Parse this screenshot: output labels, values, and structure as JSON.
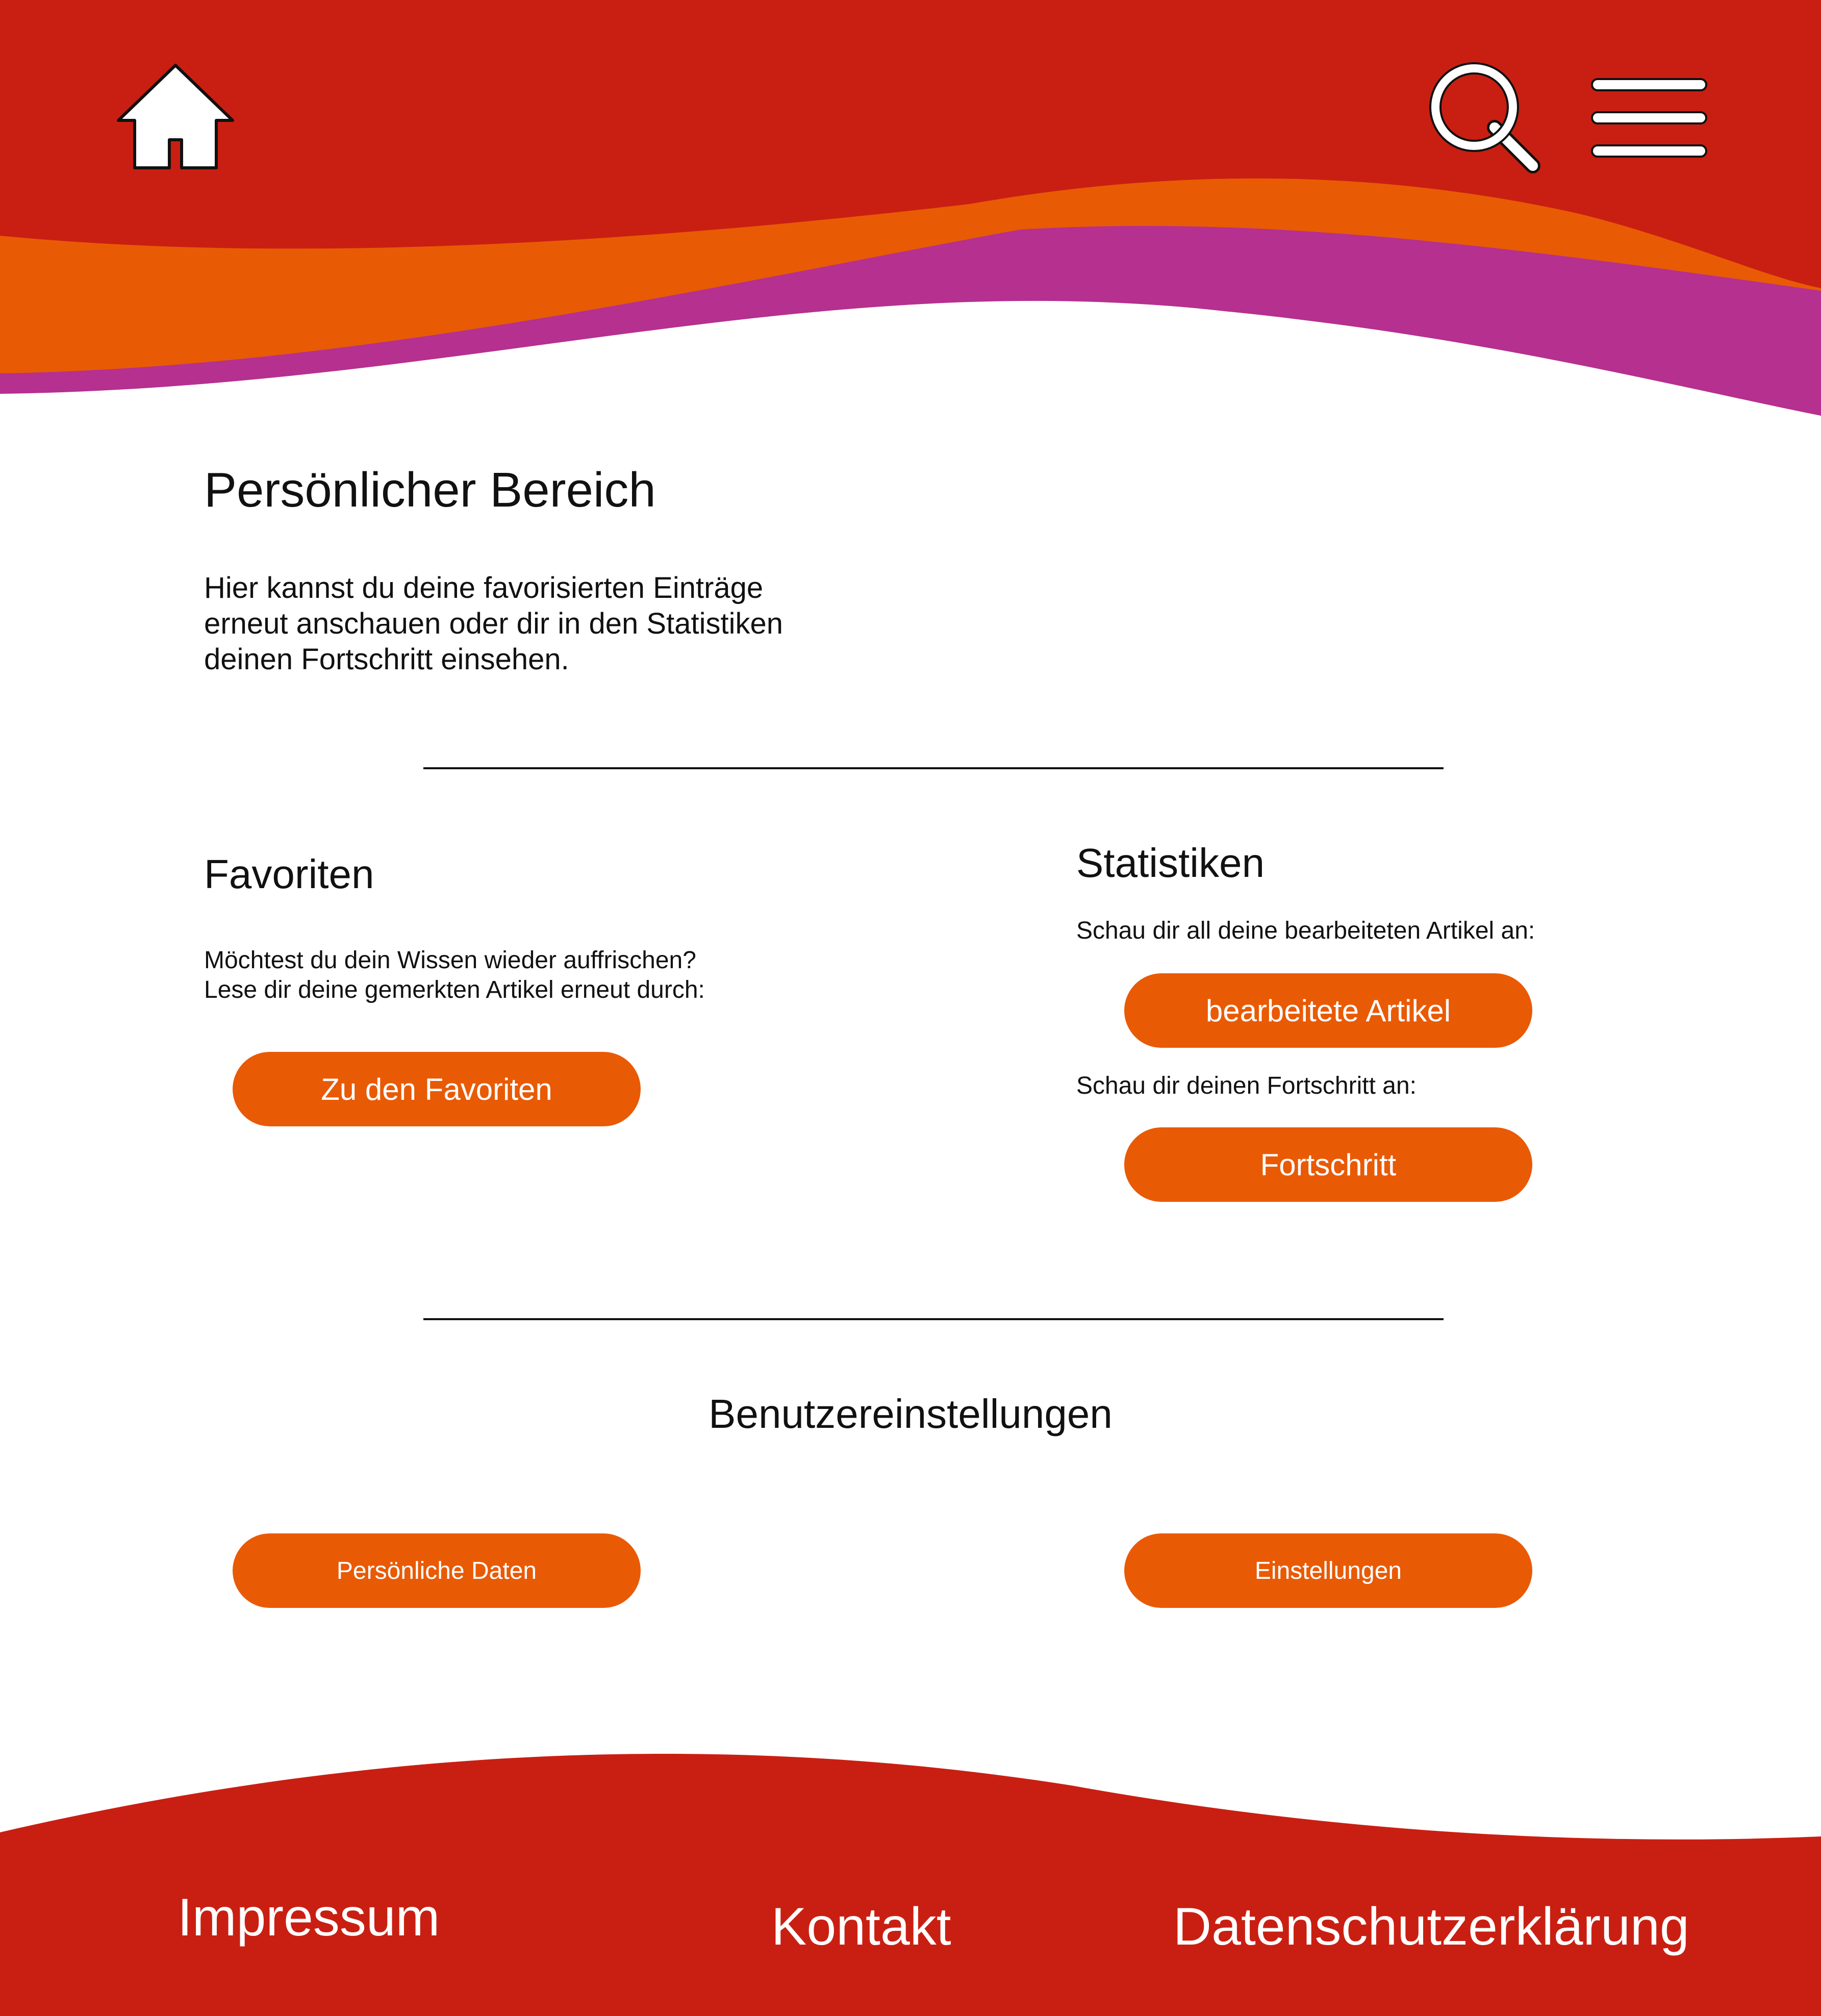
{
  "colors": {
    "red": "#c91f12",
    "orange": "#e95a05",
    "purple": "#b5308f",
    "white": "#ffffff",
    "text": "#111111"
  },
  "header": {
    "icons": [
      "home-icon",
      "search-icon",
      "menu-icon"
    ]
  },
  "main": {
    "title": "Persönlicher Bereich",
    "intro_lines": [
      "Hier kannst du deine favorisierten Einträge",
      "erneut anschauen oder dir in den Statistiken",
      "deinen Fortschritt einsehen."
    ],
    "favorites": {
      "heading": "Favoriten",
      "text_lines": [
        "Möchtest du dein Wissen wieder auffrischen?",
        "Lese dir deine gemerkten Artikel erneut durch:"
      ],
      "button": "Zu den Favoriten"
    },
    "statistics": {
      "heading": "Statistiken",
      "text_articles": "Schau dir all deine bearbeiteten Artikel an:",
      "button_articles": "bearbeitete Artikel",
      "text_progress": "Schau dir deinen Fortschritt an:",
      "button_progress": "Fortschritt"
    },
    "user_settings": {
      "heading": "Benutzereinstellungen",
      "button_personal": "Persönliche Daten",
      "button_settings": "Einstellungen"
    }
  },
  "footer": {
    "links": [
      "Impressum",
      "Kontakt",
      "Datenschutzerklärung"
    ]
  }
}
